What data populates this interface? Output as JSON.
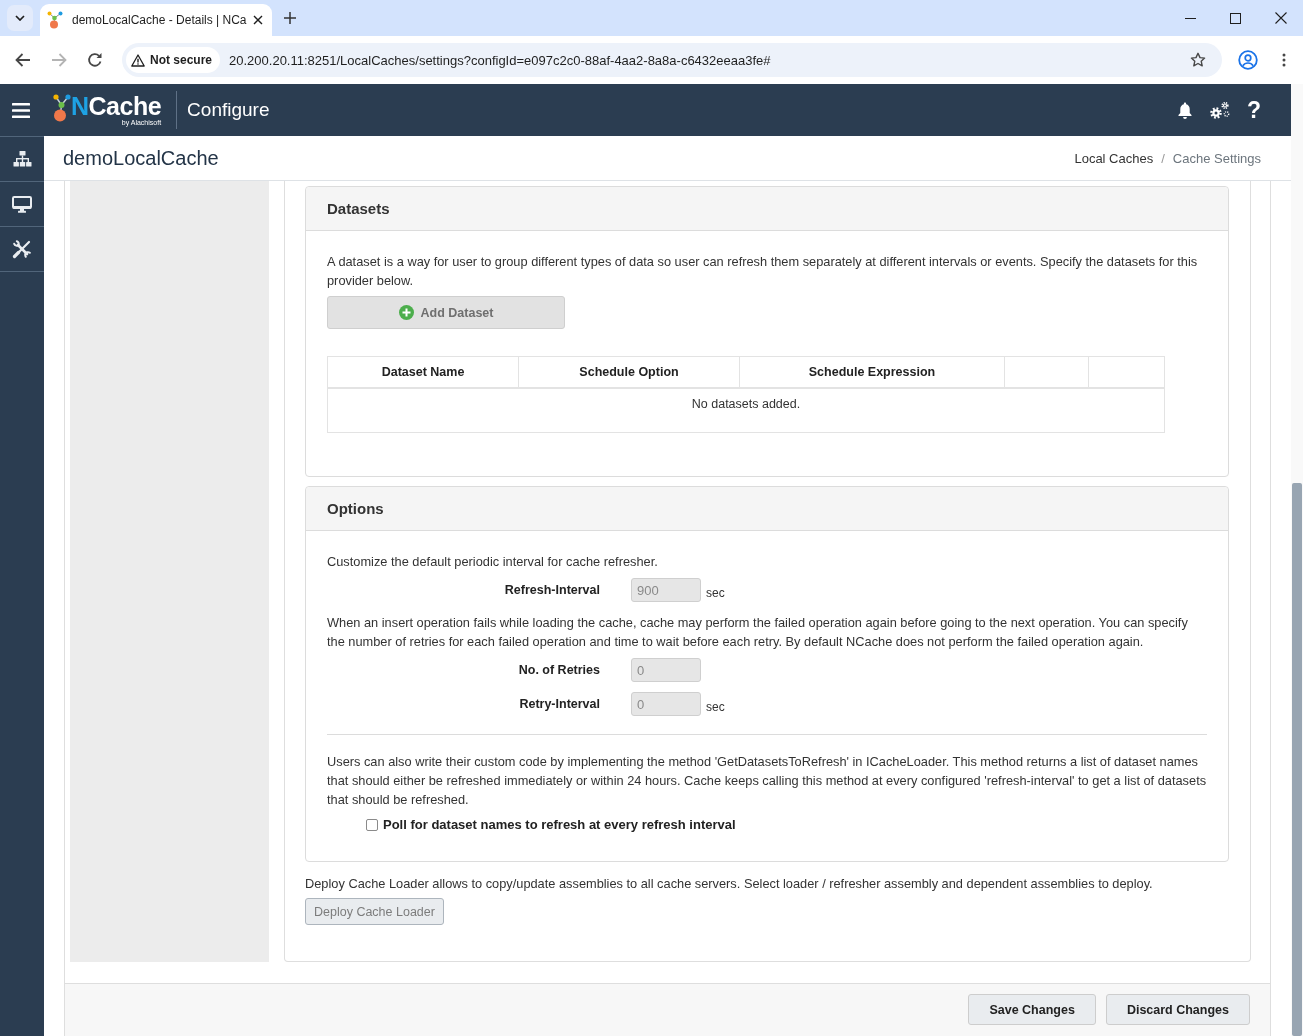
{
  "browser": {
    "tab": {
      "title": "demoLocalCache - Details | NCa"
    },
    "nav": {
      "forward_disabled": true
    },
    "address": {
      "security": "Not secure",
      "url": "20.200.20.11:8251/LocalCaches/settings?configId=e097c2c0-88af-4aa2-8a8a-c6432eeaa3fe#"
    }
  },
  "header": {
    "logo": {
      "name": "NCache",
      "byline": "by Alachisoft"
    },
    "section": "Configure",
    "help": "?"
  },
  "sidebar": {
    "items": [
      {
        "kind": "network"
      },
      {
        "kind": "monitor"
      },
      {
        "kind": "tools"
      }
    ]
  },
  "page": {
    "title": "demoLocalCache",
    "breadcrumb": {
      "separator": "/",
      "items": [
        {
          "label": "Local Caches",
          "active": false
        },
        {
          "label": "Cache Settings",
          "active": true
        }
      ]
    }
  },
  "datasets": {
    "title": "Datasets",
    "description": "A dataset is a way for user to group different types of data so user can refresh them separately at different intervals or events. Specify the datasets for this provider below.",
    "add_button": "Add Dataset",
    "table": {
      "columns": [
        {
          "kind": "label",
          "label": "Dataset Name"
        },
        {
          "kind": "label",
          "label": "Schedule Option"
        },
        {
          "kind": "label",
          "label": "Schedule Expression"
        },
        {
          "kind": "blank"
        },
        {
          "kind": "blank"
        }
      ],
      "empty_message": "No datasets added."
    }
  },
  "options": {
    "title": "Options",
    "items": [
      {
        "kind": "text",
        "text": "Customize the default periodic interval for cache refresher."
      },
      {
        "kind": "field",
        "label": "Refresh-Interval",
        "value": "900",
        "unit": "sec",
        "disabled": true
      },
      {
        "kind": "text",
        "text": "When an insert operation fails while loading the cache, cache may perform the failed operation again before going to the next operation. You can specify the number of retries for each failed operation and time to wait before each retry. By default NCache does not perform the failed operation again."
      },
      {
        "kind": "field",
        "label": "No. of Retries",
        "value": "0",
        "disabled": true
      },
      {
        "kind": "field",
        "label": "Retry-Interval",
        "value": "0",
        "unit": "sec",
        "disabled": true
      },
      {
        "kind": "divider"
      },
      {
        "kind": "text",
        "text": "Users can also write their custom code by implementing the method 'GetDatasetsToRefresh' in ICacheLoader. This method returns a list of dataset names that should either be refreshed immediately or within 24 hours. Cache keeps calling this method at every configured 'refresh-interval' to get a list of datasets that should be refreshed."
      },
      {
        "kind": "checkbox",
        "label": "Poll for dataset names to refresh at every refresh interval",
        "checked": false
      }
    ]
  },
  "deploy": {
    "description": "Deploy Cache Loader allows to copy/update assemblies to all cache servers. Select loader / refresher assembly and dependent assemblies to deploy.",
    "button": {
      "label": "Deploy Cache Loader",
      "disabled": true
    }
  },
  "footer": {
    "buttons": [
      "Save Changes",
      "Discard Changes"
    ]
  }
}
